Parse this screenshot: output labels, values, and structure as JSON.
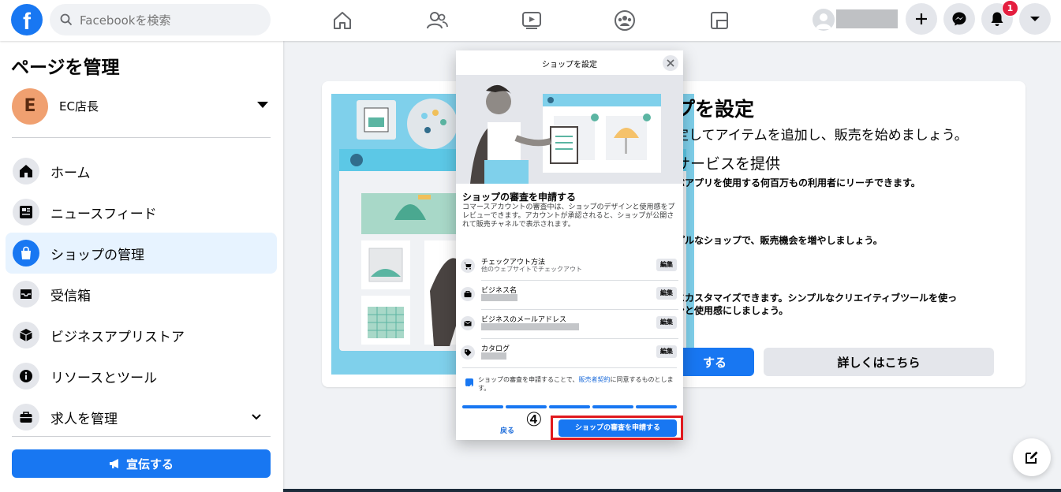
{
  "topbar": {
    "logo": "f",
    "search_placeholder": "Facebookを検索",
    "notification_count": "1"
  },
  "sidebar": {
    "title": "ページを管理",
    "page_initial": "E",
    "page_name": "EC店長",
    "items": [
      {
        "label": "ホーム",
        "icon": "home-icon"
      },
      {
        "label": "ニュースフィード",
        "icon": "news-feed-icon"
      },
      {
        "label": "ショップの管理",
        "icon": "shopping-bag-icon"
      },
      {
        "label": "受信箱",
        "icon": "inbox-icon"
      },
      {
        "label": "ビジネスアプリストア",
        "icon": "cube-icon"
      },
      {
        "label": "リソースとツール",
        "icon": "info-icon"
      },
      {
        "label": "求人を管理",
        "icon": "briefcase-icon"
      }
    ],
    "promote_label": "宣伝する"
  },
  "background": {
    "title": "プを設定",
    "line1": "定してアイテムを追加し、販売を始めましょう。",
    "line2": "サービスを提供",
    "line3": "ぶアプリを使用する何百万もの利用者にリーチできます。",
    "line4": "プルなショップで、販売機会を増やしましょう。",
    "line5": "にカスタマイズできます。シンプルなクリエイティブツールを使っ",
    "line6": "ンと使用感にしましょう。",
    "primary_btn": "する",
    "secondary_btn": "詳しくはこちら"
  },
  "modal": {
    "title": "ショップを設定",
    "heading": "ショップの審査を申請する",
    "description": "コマースアカウントの審査中は、ショップのデザインと使用感をプレビューできます。アカウントが承認されると、ショップが公開されて販売チャネルで表示されます。",
    "rows": [
      {
        "label": "チェックアウト方法",
        "sub": "他のウェブサイトでチェックアウト",
        "edit": "編集"
      },
      {
        "label": "ビジネス名",
        "sub": "",
        "edit": "編集"
      },
      {
        "label": "ビジネスのメールアドレス",
        "sub": "",
        "edit": "編集"
      },
      {
        "label": "カタログ",
        "sub": "",
        "edit": "編集"
      }
    ],
    "terms_prefix": "ショップの審査を申請することで、",
    "terms_link": "販売者契約",
    "terms_suffix": "に同意するものとします。",
    "back": "戻る",
    "submit": "ショップの審査を申請する"
  },
  "annotation": {
    "step": "④"
  },
  "colors": {
    "brand": "#1877f2",
    "highlight": "#e0191e"
  }
}
